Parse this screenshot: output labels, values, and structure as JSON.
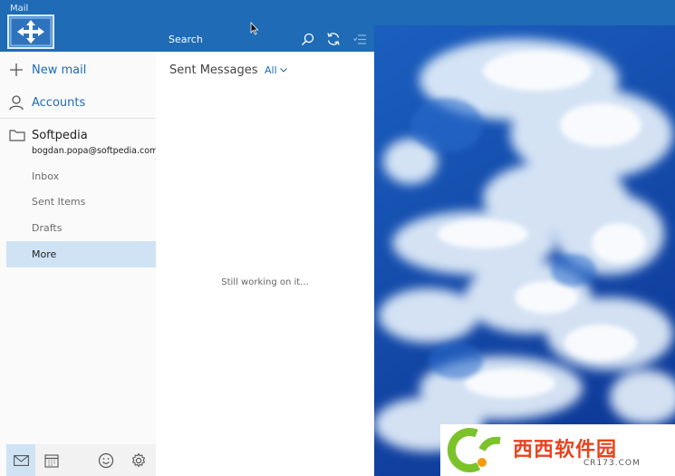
{
  "app": {
    "title": "Mail"
  },
  "nav": {
    "new_mail_label": "New mail",
    "accounts_label": "Accounts",
    "account_name": "Softpedia",
    "account_email": "bogdan.popa@softpedia.com",
    "folders": [
      {
        "label": "Inbox",
        "selected": false
      },
      {
        "label": "Sent Items",
        "selected": false
      },
      {
        "label": "Drafts",
        "selected": false
      },
      {
        "label": "More",
        "selected": true
      }
    ],
    "bottom_icons": [
      "mail-icon",
      "calendar-icon",
      "smiley-icon",
      "gear-icon"
    ]
  },
  "list": {
    "search_placeholder": "Search",
    "header": "Sent Messages",
    "filter": "All",
    "status": "Still working on it..."
  },
  "watermark": {
    "text": "西西软件园",
    "domain": "CR173.COM"
  },
  "colors": {
    "accent": "#1f6bb5",
    "selection": "#cfe3f5",
    "link": "#1c6dba",
    "sky_dark": "#1548a6"
  }
}
